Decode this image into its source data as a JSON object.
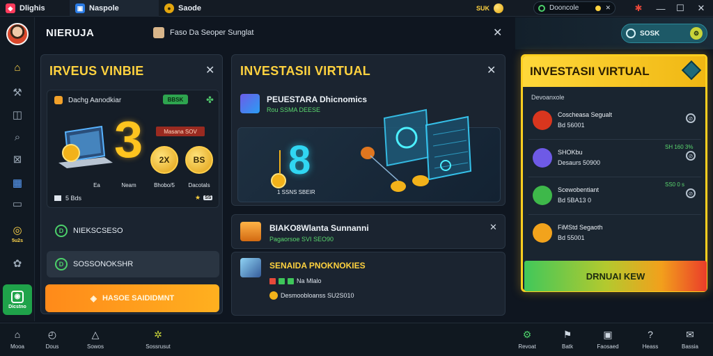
{
  "tabs": [
    {
      "label": "Dlighis",
      "icon": "app-icon"
    },
    {
      "label": "Naspole",
      "icon": "document-icon"
    },
    {
      "label": "Saode",
      "icon": "coin-icon"
    }
  ],
  "topbar": {
    "coin_text": "SUK",
    "search_text": "Dooncole"
  },
  "header": {
    "brand": "NIERUJA",
    "message": "Faso Da Seoper Sunglat"
  },
  "right_header": {
    "search_label": "SOSK"
  },
  "sidebar": {
    "badge_label": "5u2s",
    "green_label": "Dicstno"
  },
  "panel1": {
    "title": "IRVEUS VINBIE",
    "card": {
      "title": "Dachg Aanodkiar",
      "green_tag": "BBSK",
      "big_number": "3",
      "red_tag": "Masana SOV",
      "bubbles": [
        {
          "value": "2X",
          "label": "Bhobo/5"
        },
        {
          "value": "BS",
          "label": "Dacotals"
        }
      ],
      "caption_small": "Ea",
      "caption_left": "Neam",
      "footer_left": "5 Bds",
      "footer_right": "SS"
    },
    "options": [
      {
        "label": "NIEKSCSESO",
        "icon": "D"
      },
      {
        "label": "SOSSONOKSHR",
        "icon": "D"
      }
    ],
    "cta": "HASOE SAIDIDMNT"
  },
  "panel2": {
    "title": "INVESTASII VIRTUAL",
    "item_name": "PEUESTARA Dhicnomics",
    "item_sub": "Rou SSMA DEESE",
    "big_number": "8",
    "stage_label": "1 SSNS SBEIR"
  },
  "panel3": {
    "name": "BIAKO8Wlanta Sunnanni",
    "sub": "Pagaorsoe SVI SEO90"
  },
  "panel4": {
    "name": "SENAIDA PNOKNOKIES",
    "line1": "Na Mlalo",
    "line2": "Desmoobloanss SU2S010"
  },
  "right_panel": {
    "title": "INVESTASII VIRTUAL",
    "section_label": "Devoanxole",
    "rows": [
      {
        "name": "Coscheasa Segualt",
        "amount": "Bd 56001",
        "pct": "",
        "color": "#d9361e"
      },
      {
        "name": "SHOKbu",
        "amount": "Desaurs 50900",
        "pct": "SH 160 3%",
        "color": "#6e5ae6"
      },
      {
        "name": "Scewobentiant",
        "amount": "Bd 5BA13  0",
        "pct": "SS0 0 s",
        "color": "#3eb84a"
      },
      {
        "name": "FiMStd Segaoth",
        "amount": "Bd 55001",
        "pct": "",
        "color": "#f2a31c"
      }
    ],
    "cta": "DRNUAI KEW"
  },
  "bottombar": {
    "items": [
      {
        "label": "Mooa",
        "icon": "home-icon"
      },
      {
        "label": "Dous",
        "icon": "clock-icon"
      },
      {
        "label": "Sowos",
        "icon": "triangle-icon"
      },
      {
        "label": "Sossrusut",
        "icon": "crypto-icon"
      },
      {
        "label": "Revoat",
        "icon": "gear-icon"
      },
      {
        "label": "Batk",
        "icon": "flag-icon"
      },
      {
        "label": "Faosaed",
        "icon": "square-icon"
      },
      {
        "label": "Heass",
        "icon": "help-icon"
      },
      {
        "label": "Bassia",
        "icon": "chat-icon"
      }
    ]
  },
  "colors": {
    "accent_yellow": "#ffd23f",
    "accent_orange": "#ff8a1a",
    "positive_green": "#5bd86f",
    "cyan": "#30d6f2"
  }
}
